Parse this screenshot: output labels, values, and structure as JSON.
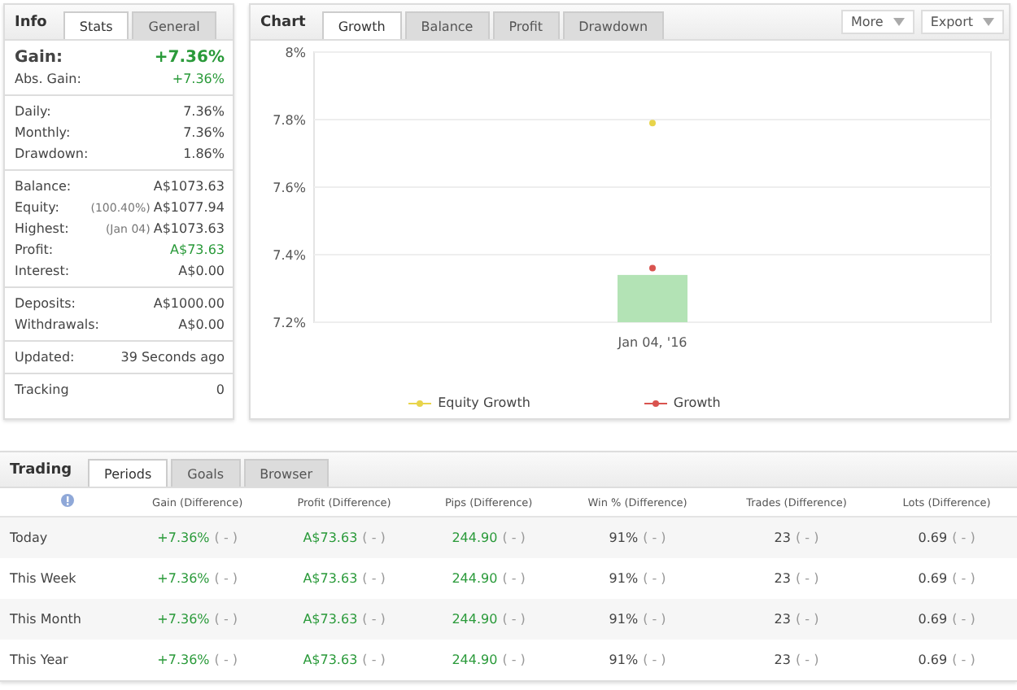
{
  "info": {
    "title": "Info",
    "tabs": [
      {
        "label": "Stats",
        "selected": true
      },
      {
        "label": "General",
        "selected": false
      }
    ],
    "groups": [
      {
        "rows": [
          {
            "kind": "headline",
            "label": "Gain:",
            "value": "+7.36%",
            "positive": true
          },
          {
            "kind": "plain",
            "label": "Abs. Gain:",
            "value": "+7.36%",
            "positive": true
          }
        ]
      },
      {
        "rows": [
          {
            "kind": "plain",
            "label": "Daily:",
            "value": "7.36%",
            "positive": false
          },
          {
            "kind": "plain",
            "label": "Monthly:",
            "value": "7.36%",
            "positive": false
          },
          {
            "kind": "plain",
            "label": "Drawdown:",
            "value": "1.86%",
            "positive": false
          }
        ]
      },
      {
        "rows": [
          {
            "kind": "plain",
            "label": "Balance:",
            "value": "A$1073.63",
            "positive": false
          },
          {
            "kind": "plain",
            "label": "Equity:",
            "note": "(100.40%)",
            "value": "A$1077.94",
            "positive": false
          },
          {
            "kind": "plain",
            "label": "Highest:",
            "note": "(Jan 04)",
            "value": "A$1073.63",
            "positive": false
          },
          {
            "kind": "plain",
            "label": "Profit:",
            "value": "A$73.63",
            "positive": true
          },
          {
            "kind": "plain",
            "label": "Interest:",
            "value": "A$0.00",
            "positive": false
          }
        ]
      },
      {
        "rows": [
          {
            "kind": "plain",
            "label": "Deposits:",
            "value": "A$1000.00",
            "positive": false
          },
          {
            "kind": "plain",
            "label": "Withdrawals:",
            "value": "A$0.00",
            "positive": false
          }
        ]
      },
      {
        "rows": [
          {
            "kind": "plain",
            "label": "Updated:",
            "value": "39 Seconds ago",
            "positive": false
          }
        ]
      },
      {
        "rows": [
          {
            "kind": "plain",
            "label": "Tracking",
            "value": "0",
            "positive": false
          }
        ]
      }
    ]
  },
  "chart": {
    "title": "Chart",
    "tabs": [
      {
        "label": "Growth",
        "selected": true
      },
      {
        "label": "Balance",
        "selected": false
      },
      {
        "label": "Profit",
        "selected": false
      },
      {
        "label": "Drawdown",
        "selected": false
      }
    ],
    "menus": [
      "More",
      "Export"
    ],
    "chart_data": {
      "type": "line",
      "grid": true,
      "categories": [
        "Jan 04, '16"
      ],
      "ylim": [
        7.2,
        8
      ],
      "yticks": [
        {
          "value": 7.2,
          "label": "7.2%"
        },
        {
          "value": 7.4,
          "label": "7.4%"
        },
        {
          "value": 7.6,
          "label": "7.6%"
        },
        {
          "value": 7.8,
          "label": "7.8%"
        },
        {
          "value": 8,
          "label": "8%"
        }
      ],
      "series": [
        {
          "name": "Equity Growth",
          "marker": true,
          "color": "#e8d44a",
          "values": [
            7.79
          ]
        },
        {
          "type": "bar",
          "color": "#b3e3b5",
          "values": [
            7.34
          ]
        },
        {
          "name": "Growth",
          "marker": true,
          "color": "#d9534f",
          "values": [
            7.36
          ]
        }
      ]
    }
  },
  "trading": {
    "title": "Trading",
    "tabs": [
      {
        "label": "Periods",
        "selected": true
      },
      {
        "label": "Goals",
        "selected": false
      },
      {
        "label": "Browser",
        "selected": false
      }
    ],
    "columns": [
      {
        "label": "Gain (Difference)",
        "positive": true
      },
      {
        "label": "Profit (Difference)",
        "positive": true
      },
      {
        "label": "Pips (Difference)",
        "positive": true
      },
      {
        "label": "Win % (Difference)",
        "positive": false
      },
      {
        "label": "Trades (Difference)",
        "positive": false
      },
      {
        "label": "Lots (Difference)",
        "positive": false
      }
    ],
    "rows": [
      {
        "label": "Today",
        "cells": [
          {
            "value": "+7.36%",
            "diff": "( - )"
          },
          {
            "value": "A$73.63",
            "diff": "( - )"
          },
          {
            "value": "244.90",
            "diff": "( - )"
          },
          {
            "value": "91%",
            "diff": "( - )"
          },
          {
            "value": "23",
            "diff": "( - )"
          },
          {
            "value": "0.69",
            "diff": "( - )"
          }
        ]
      },
      {
        "label": "This Week",
        "cells": [
          {
            "value": "+7.36%",
            "diff": "( - )"
          },
          {
            "value": "A$73.63",
            "diff": "( - )"
          },
          {
            "value": "244.90",
            "diff": "( - )"
          },
          {
            "value": "91%",
            "diff": "( - )"
          },
          {
            "value": "23",
            "diff": "( - )"
          },
          {
            "value": "0.69",
            "diff": "( - )"
          }
        ]
      },
      {
        "label": "This Month",
        "cells": [
          {
            "value": "+7.36%",
            "diff": "( - )"
          },
          {
            "value": "A$73.63",
            "diff": "( - )"
          },
          {
            "value": "244.90",
            "diff": "( - )"
          },
          {
            "value": "91%",
            "diff": "( - )"
          },
          {
            "value": "23",
            "diff": "( - )"
          },
          {
            "value": "0.69",
            "diff": "( - )"
          }
        ]
      },
      {
        "label": "This Year",
        "cells": [
          {
            "value": "+7.36%",
            "diff": "( - )"
          },
          {
            "value": "A$73.63",
            "diff": "( - )"
          },
          {
            "value": "244.90",
            "diff": "( - )"
          },
          {
            "value": "91%",
            "diff": "( - )"
          },
          {
            "value": "23",
            "diff": "( - )"
          },
          {
            "value": "0.69",
            "diff": "( - )"
          }
        ]
      }
    ]
  }
}
